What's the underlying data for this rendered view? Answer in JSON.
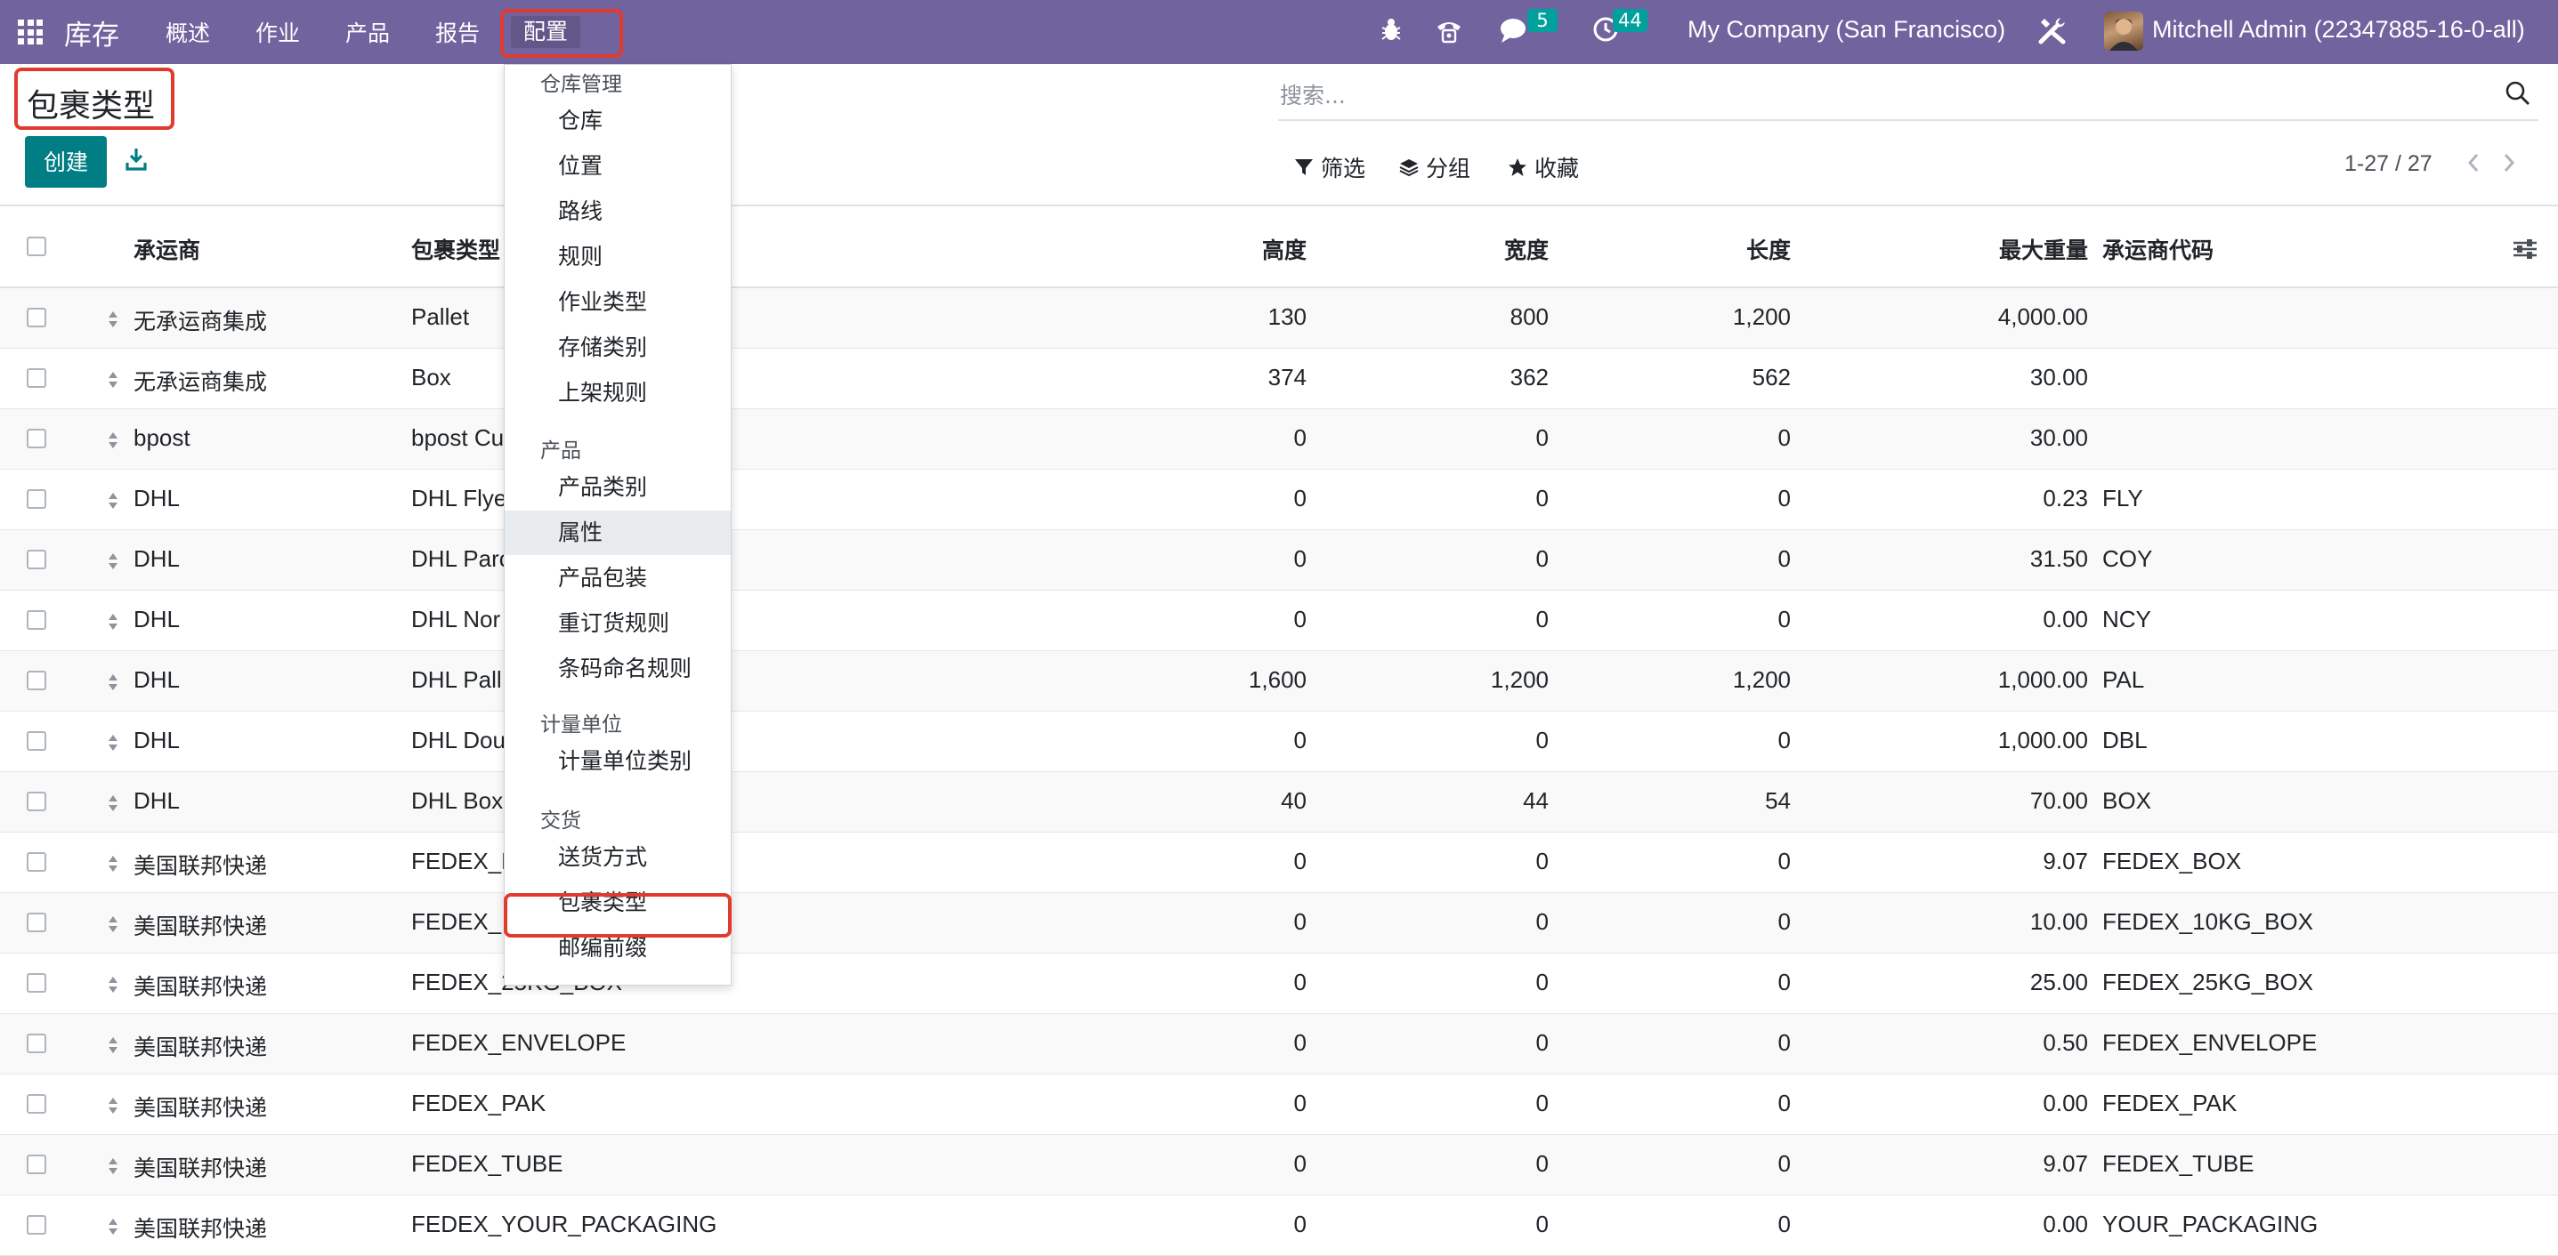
{
  "navbar": {
    "app_name": "库存",
    "menu": [
      "概述",
      "作业",
      "产品",
      "报告",
      "配置"
    ],
    "active_menu": "配置",
    "messages_count": "5",
    "activities_count": "44",
    "company": "My Company (San Francisco)",
    "user": "Mitchell Admin (22347885-16-0-all)",
    "accent_color": "#71639e"
  },
  "control_panel": {
    "title": "包裹类型",
    "create_label": "创建",
    "search_placeholder": "搜索...",
    "filter_label": "筛选",
    "group_label": "分组",
    "favorite_label": "收藏",
    "pager": "1-27 / 27"
  },
  "table": {
    "headers": {
      "carrier": "承运商",
      "package_type": "包裹类型",
      "height": "高度",
      "width": "宽度",
      "length": "长度",
      "max_weight": "最大重量",
      "carrier_code": "承运商代码"
    },
    "rows": [
      {
        "carrier": "无承运商集成",
        "package_type": "Pallet",
        "height": "130",
        "width": "800",
        "length": "1,200",
        "max_weight": "4,000.00",
        "code": ""
      },
      {
        "carrier": "无承运商集成",
        "package_type": "Box",
        "height": "374",
        "width": "362",
        "length": "562",
        "max_weight": "30.00",
        "code": ""
      },
      {
        "carrier": "bpost",
        "package_type": "bpost Cu",
        "height": "0",
        "width": "0",
        "length": "0",
        "max_weight": "30.00",
        "code": ""
      },
      {
        "carrier": "DHL",
        "package_type": "DHL Flye",
        "height": "0",
        "width": "0",
        "length": "0",
        "max_weight": "0.23",
        "code": "FLY"
      },
      {
        "carrier": "DHL",
        "package_type": "DHL Parc",
        "height": "0",
        "width": "0",
        "length": "0",
        "max_weight": "31.50",
        "code": "COY"
      },
      {
        "carrier": "DHL",
        "package_type": "DHL Nor",
        "height": "0",
        "width": "0",
        "length": "0",
        "max_weight": "0.00",
        "code": "NCY"
      },
      {
        "carrier": "DHL",
        "package_type": "DHL Pall",
        "height": "1,600",
        "width": "1,200",
        "length": "1,200",
        "max_weight": "1,000.00",
        "code": "PAL"
      },
      {
        "carrier": "DHL",
        "package_type": "DHL Dou",
        "height": "0",
        "width": "0",
        "length": "0",
        "max_weight": "1,000.00",
        "code": "DBL"
      },
      {
        "carrier": "DHL",
        "package_type": "DHL Box",
        "height": "40",
        "width": "44",
        "length": "54",
        "max_weight": "70.00",
        "code": "BOX"
      },
      {
        "carrier": "美国联邦快递",
        "package_type": "FEDEX_B",
        "height": "0",
        "width": "0",
        "length": "0",
        "max_weight": "9.07",
        "code": "FEDEX_BOX"
      },
      {
        "carrier": "美国联邦快递",
        "package_type": "FEDEX_",
        "height": "0",
        "width": "0",
        "length": "0",
        "max_weight": "10.00",
        "code": "FEDEX_10KG_BOX"
      },
      {
        "carrier": "美国联邦快递",
        "package_type": "FEDEX_25KG_BOX",
        "height": "0",
        "width": "0",
        "length": "0",
        "max_weight": "25.00",
        "code": "FEDEX_25KG_BOX"
      },
      {
        "carrier": "美国联邦快递",
        "package_type": "FEDEX_ENVELOPE",
        "height": "0",
        "width": "0",
        "length": "0",
        "max_weight": "0.50",
        "code": "FEDEX_ENVELOPE"
      },
      {
        "carrier": "美国联邦快递",
        "package_type": "FEDEX_PAK",
        "height": "0",
        "width": "0",
        "length": "0",
        "max_weight": "0.00",
        "code": "FEDEX_PAK"
      },
      {
        "carrier": "美国联邦快递",
        "package_type": "FEDEX_TUBE",
        "height": "0",
        "width": "0",
        "length": "0",
        "max_weight": "9.07",
        "code": "FEDEX_TUBE"
      },
      {
        "carrier": "美国联邦快递",
        "package_type": "FEDEX_YOUR_PACKAGING",
        "height": "0",
        "width": "0",
        "length": "0",
        "max_weight": "0.00",
        "code": "YOUR_PACKAGING"
      }
    ]
  },
  "dropdown": {
    "sections": [
      {
        "header": "仓库管理",
        "items": [
          "仓库",
          "位置",
          "路线",
          "规则",
          "作业类型",
          "存储类别",
          "上架规则"
        ]
      },
      {
        "header": "产品",
        "items": [
          "产品类别",
          "属性",
          "产品包装",
          "重订货规则",
          "条码命名规则"
        ]
      },
      {
        "header": "计量单位",
        "items": [
          "计量单位类别"
        ]
      },
      {
        "header": "交货",
        "items": [
          "送货方式",
          "包裹类型",
          "邮编前缀"
        ]
      }
    ],
    "hovered_item": "属性",
    "highlighted_item": "包裹类型"
  }
}
